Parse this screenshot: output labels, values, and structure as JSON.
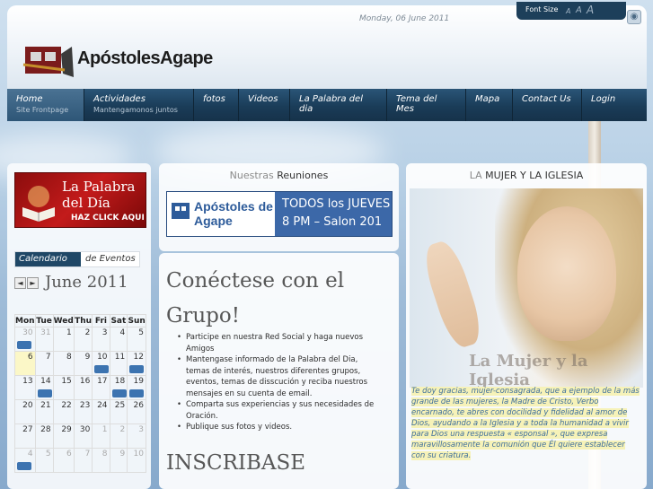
{
  "header": {
    "date": "Monday, 06 June 2011",
    "font_size_label": "Font Size",
    "font_size_options": [
      "A",
      "A",
      "A"
    ],
    "logo_text": "ApóstolesAgape",
    "rss_icon": "rss-icon"
  },
  "nav": {
    "items": [
      {
        "label": "Home",
        "sub": "Site Frontpage"
      },
      {
        "label": "Actividades",
        "sub": "Mantengamonos juntos"
      },
      {
        "label": "fotos",
        "sub": ""
      },
      {
        "label": "Videos",
        "sub": ""
      },
      {
        "label": "La Palabra del dia",
        "sub": ""
      },
      {
        "label": "Tema del Mes",
        "sub": ""
      },
      {
        "label": "Mapa",
        "sub": ""
      },
      {
        "label": "Contact Us",
        "sub": ""
      },
      {
        "label": "Login",
        "sub": ""
      }
    ]
  },
  "left": {
    "banner": {
      "line1": "La Palabra",
      "line2": "del Día",
      "line3": "HAZ CLICK AQUI"
    },
    "calendar": {
      "chip": "Calendario",
      "chip_suffix": "de Eventos",
      "prev": "◄",
      "next": "►",
      "month": "June 2011",
      "days": [
        "Mon",
        "Tue",
        "Wed",
        "Thu",
        "Fri",
        "Sat",
        "Sun"
      ]
    }
  },
  "reuniones": {
    "title_light": "Nuestras",
    "title_dark": "Reuniones",
    "banner_logo": "Apóstoles de Agape",
    "line1": "TODOS los JUEVES",
    "line2": "8 PM – Salon 201"
  },
  "conectese": {
    "title": "Conéctese con el Grupo!",
    "items": [
      "Participe en nuestra Red Social y haga nuevos Amigos",
      "Mantengase informado de la Palabra del Dia, temas de interés, nuestros diferentes grupos, eventos, temas de disscución y reciba nuestros mensajes en su cuenta de email.",
      "Comparta sus experiencias y sus necesidades de Oración.",
      "Publique sus fotos y videos."
    ],
    "inscribase": "INSCRIBASE"
  },
  "mujer": {
    "title_light": "LA",
    "title_dark": "MUJER Y LA IGLESIA",
    "watermark": "La Mujer y la Iglesia",
    "quote": "Te doy gracias, mujer-consagrada, que a ejemplo de la más grande de las mujeres, la Madre de Cristo, Verbo encarnado, te abres con docilidad y fidelidad al amor de Dios, ayudando a la Iglesia y a toda la humanidad a vivir para Dios una respuesta « esponsal », que expresa maravillosamente la comunión que Él quiere establecer con su criatura."
  }
}
